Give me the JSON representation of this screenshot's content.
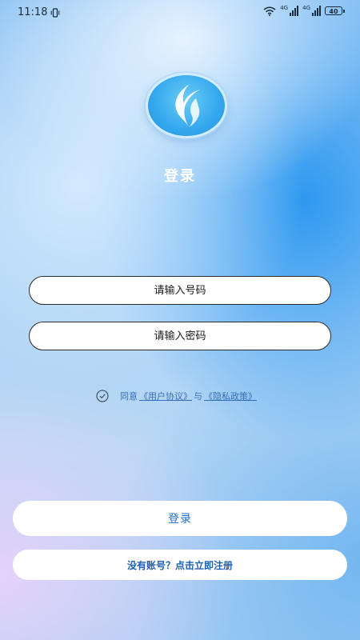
{
  "status_bar": {
    "time": "11:18",
    "network_1_label": "4G",
    "network_2_label": "4G",
    "battery_level": "40",
    "icons": [
      "vibrate-icon",
      "wifi-icon",
      "signal-icon",
      "signal-icon",
      "battery-icon"
    ]
  },
  "logo": {
    "icon": "flame-logo-icon",
    "colors": {
      "inner": "#34a8ee",
      "ring": "#dcf0ff"
    }
  },
  "page": {
    "title": "登录"
  },
  "form": {
    "phone_placeholder": "请输入号码",
    "phone_value": "",
    "password_placeholder": "请输入密码",
    "password_value": ""
  },
  "agreement": {
    "prefix": "同意",
    "user_agreement_link": "《用户协议》",
    "separator": "与",
    "privacy_policy_link": "《隐私政策》",
    "checked": false
  },
  "buttons": {
    "login_label": "登录",
    "register_label": "没有账号？点击立即注册"
  },
  "colors": {
    "accent": "#1f6fc4",
    "link": "#3a6db8",
    "background_primary": "#2896f0"
  }
}
